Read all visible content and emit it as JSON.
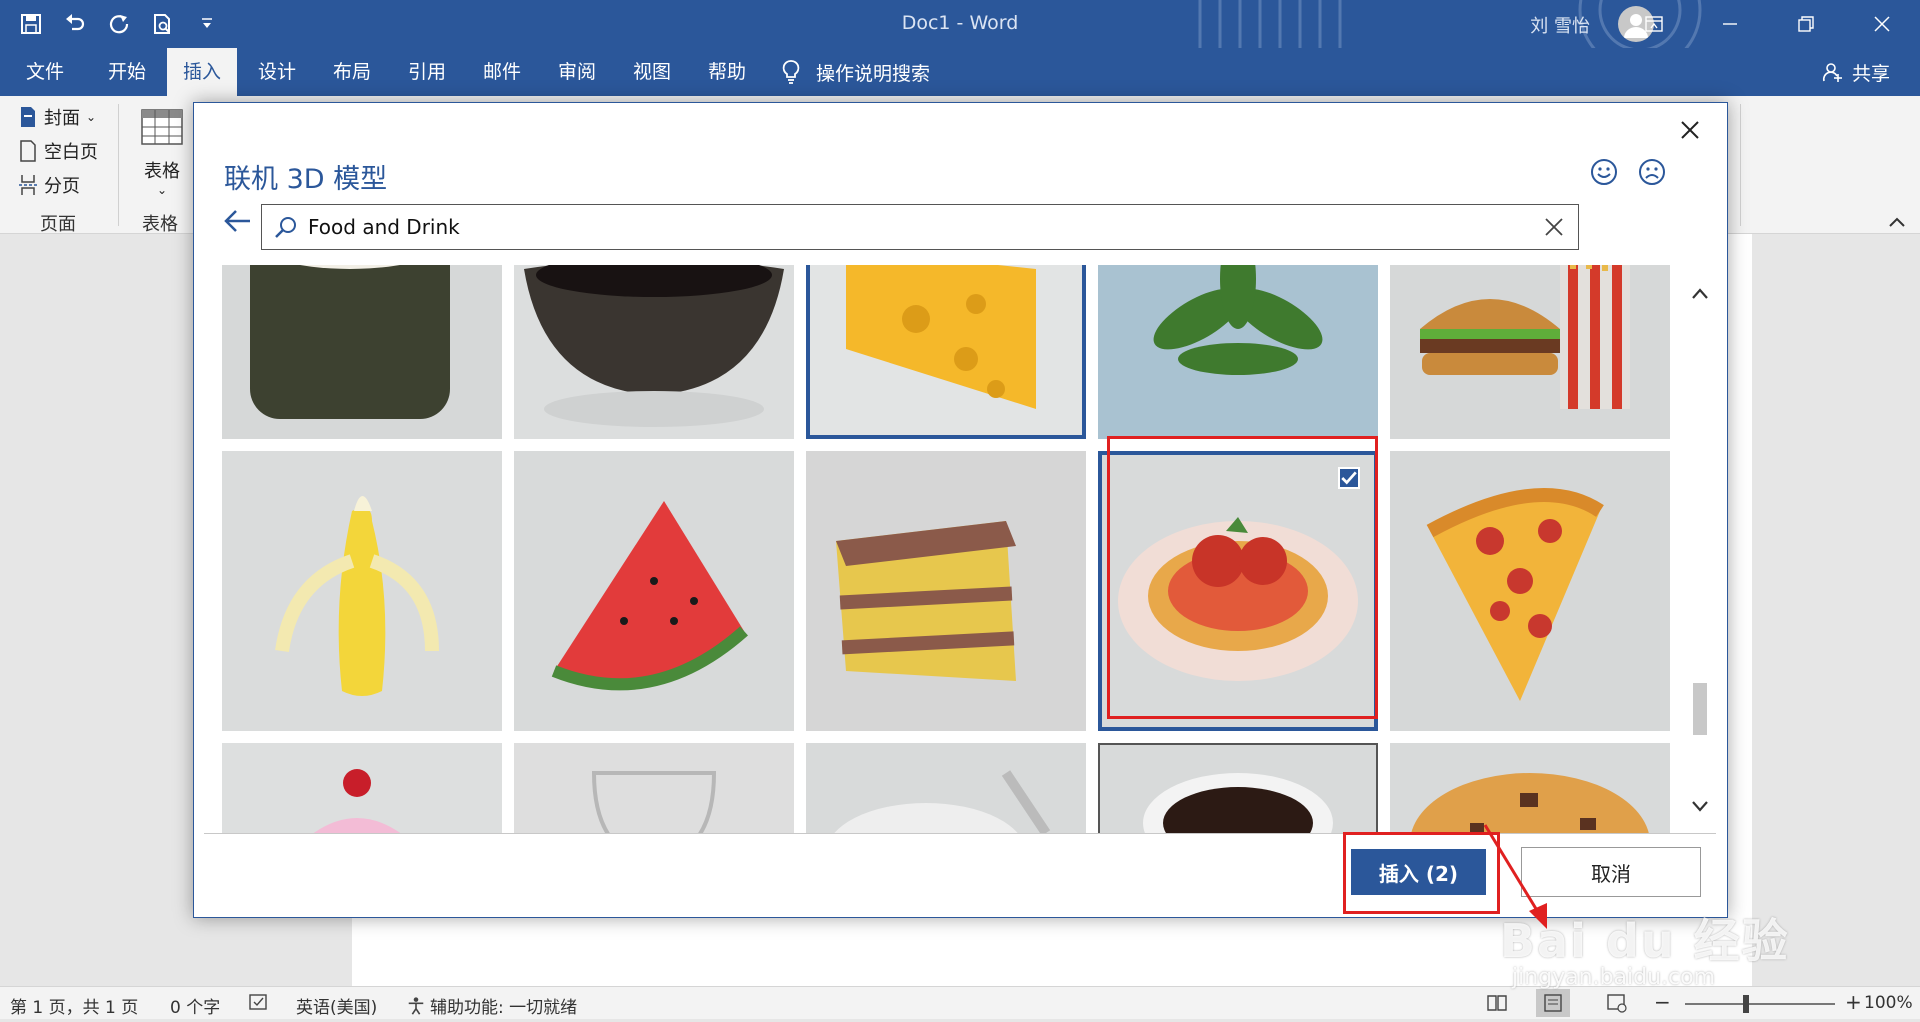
{
  "titlebar": {
    "doc_title": "Doc1  -  Word",
    "user_name": "刘 雪怡"
  },
  "tabs": [
    "文件",
    "开始",
    "插入",
    "设计",
    "布局",
    "引用",
    "邮件",
    "审阅",
    "视图",
    "帮助"
  ],
  "active_tab": "插入",
  "tell_me": "操作说明搜索",
  "share": "共享",
  "ribbon": {
    "cover": "封面",
    "blank_page": "空白页",
    "page_break": "分页",
    "pages_group": "页面",
    "table_btn": "表格",
    "table_group": "表格"
  },
  "dialog": {
    "title": "联机 3D 模型",
    "search_value": "Food and Drink",
    "insert_label": "插入 (2)",
    "cancel_label": "取消"
  },
  "gallery": {
    "row1": [
      "sushi",
      "soy sauce bowl",
      "cheese",
      "plant",
      "burger and fries"
    ],
    "row2": [
      "banana",
      "watermelon",
      "layer cake",
      "spaghetti and meatballs",
      "pizza slice"
    ],
    "row3": [
      "cupcake",
      "wine glass",
      "plate with knife",
      "coffee cup",
      "cookie"
    ],
    "selected": [
      "cheese",
      "spaghetti and meatballs"
    ]
  },
  "status": {
    "page": "第 1 页，共 1 页",
    "words": "0 个字",
    "language": "英语(美国)",
    "accessibility": "辅助功能: 一切就绪",
    "zoom": "100%"
  },
  "watermark": {
    "logo_text": "Bai du 经验",
    "url": "jingyan.baidu.com"
  },
  "colors": {
    "brand": "#2b579a",
    "highlight": "#e02020"
  }
}
